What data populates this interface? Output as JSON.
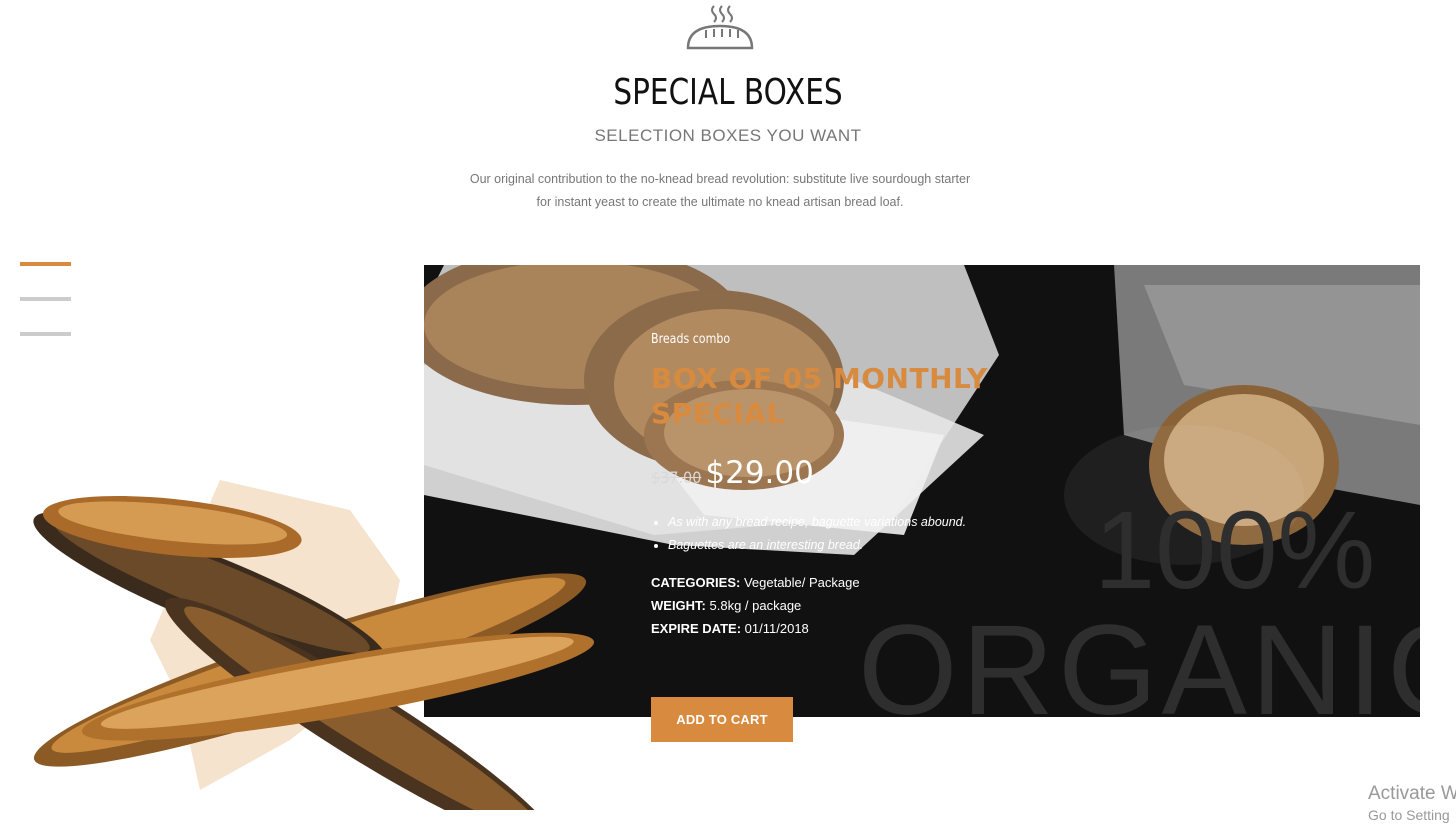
{
  "section": {
    "icon": "bread-loaf-icon",
    "title": "SPECIAL BOXES",
    "subtitle": "SELECTION BOXES YOU WANT",
    "description_line1": "Our original contribution to the no-knead bread revolution: substitute live sourdough starter",
    "description_line2": "for instant yeast to create the ultimate no knead artisan bread loaf."
  },
  "slider": {
    "slide_count": 3,
    "active_index": 0
  },
  "product": {
    "eyebrow": "Breads combo",
    "title_line1": "BOX OF 05 MONTHLY",
    "title_line2": "SPECIAL",
    "old_price": "$37.00",
    "price": "$29.00",
    "features": [
      "As with any bread recipe, baguette variations abound.",
      "Baguettes are an interesting bread."
    ],
    "categories_label": "CATEGORIES:",
    "categories_value": " Vegetable/ Package",
    "weight_label": "WEIGHT:",
    "weight_value": " 5.8kg / package",
    "expire_label": "EXPIRE DATE:",
    "expire_value": " 01/11/2018",
    "button_label": "ADD TO CART",
    "watermark_line1": "100%",
    "watermark_line2": "ORGANIC"
  },
  "system_overlay": {
    "line1": "Activate W",
    "line2": "Go to Setting"
  },
  "colors": {
    "accent": "#d88a3f",
    "panel_bg": "#111111",
    "text_muted": "#777777"
  }
}
